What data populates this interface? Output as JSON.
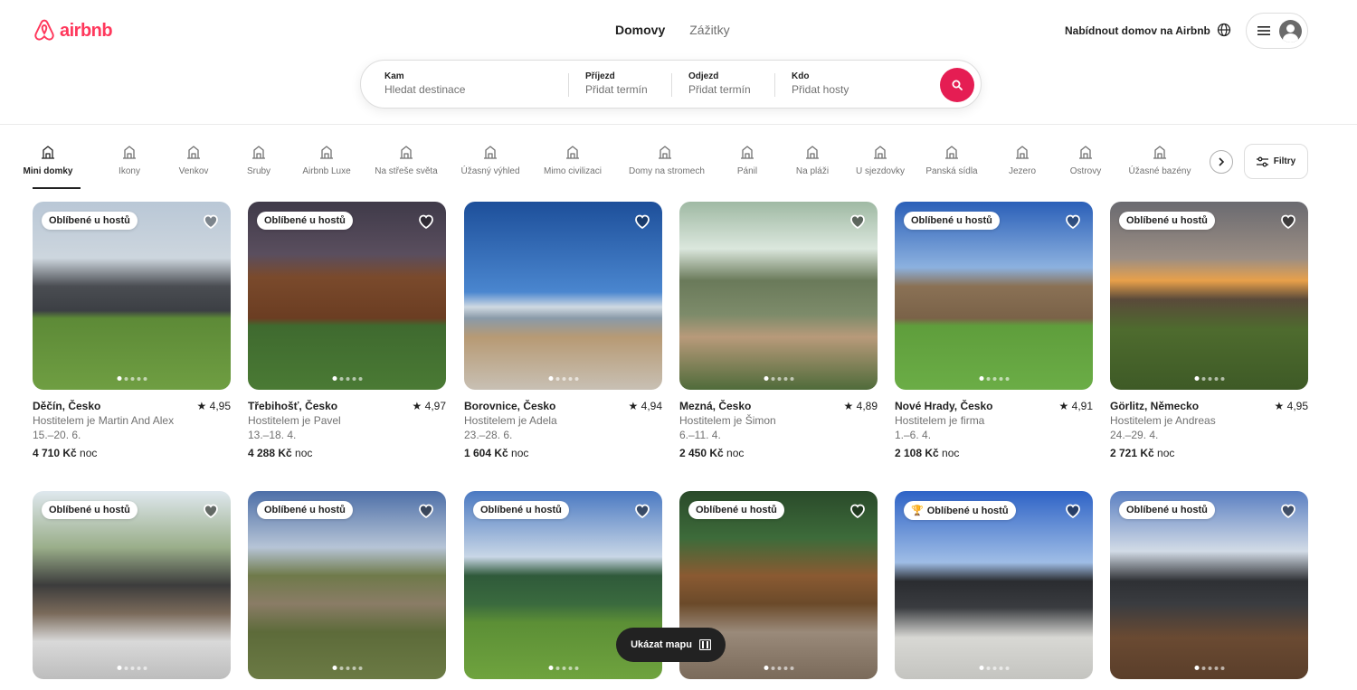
{
  "header": {
    "logo_text": "airbnb",
    "tabs": [
      {
        "label": "Domovy",
        "active": true
      },
      {
        "label": "Zážitky",
        "active": false
      }
    ],
    "host_link": "Nabídnout domov na Airbnb"
  },
  "search": {
    "where": {
      "label": "Kam",
      "placeholder": "Hledat destinace"
    },
    "checkin": {
      "label": "Příjezd",
      "placeholder": "Přidat termín"
    },
    "checkout": {
      "label": "Odjezd",
      "placeholder": "Přidat termín"
    },
    "who": {
      "label": "Kdo",
      "placeholder": "Přidat hosty"
    }
  },
  "categories": [
    {
      "label": "Mini domky",
      "active": true
    },
    {
      "label": "Ikony"
    },
    {
      "label": "Venkov"
    },
    {
      "label": "Sruby"
    },
    {
      "label": "Airbnb Luxe"
    },
    {
      "label": "Na střeše světa"
    },
    {
      "label": "Úžasný výhled"
    },
    {
      "label": "Mimo civilizaci"
    },
    {
      "label": "Domy na stromech"
    },
    {
      "label": "Pánil"
    },
    {
      "label": "Na pláži"
    },
    {
      "label": "U sjezdovky"
    },
    {
      "label": "Panská sídla"
    },
    {
      "label": "Jezero"
    },
    {
      "label": "Ostrovy"
    },
    {
      "label": "Úžasné bazény"
    }
  ],
  "filters_label": "Filtry",
  "listings": [
    {
      "badge": "Oblíbené u hostů",
      "location": "Děčín, Česko",
      "rating": "★ 4,95",
      "host": "Hostitelem je Martin And Alex",
      "dates": "15.–20. 6.",
      "price": "4 710 Kč",
      "unit": "noc"
    },
    {
      "badge": "Oblíbené u hostů",
      "location": "Třebihošť, Česko",
      "rating": "★ 4,97",
      "host": "Hostitelem je Pavel",
      "dates": "13.–18. 4.",
      "price": "4 288 Kč",
      "unit": "noc"
    },
    {
      "badge": "",
      "location": "Borovnice, Česko",
      "rating": "★ 4,94",
      "host": "Hostitelem je Adela",
      "dates": "23.–28. 6.",
      "price": "1 604 Kč",
      "unit": "noc"
    },
    {
      "badge": "",
      "location": "Mezná, Česko",
      "rating": "★ 4,89",
      "host": "Hostitelem je Šimon",
      "dates": "6.–11. 4.",
      "price": "2 450 Kč",
      "unit": "noc"
    },
    {
      "badge": "Oblíbené u hostů",
      "location": "Nové Hrady, Česko",
      "rating": "★ 4,91",
      "host": "Hostitelem je firma",
      "dates": "1.–6. 4.",
      "price": "2 108 Kč",
      "unit": "noc"
    },
    {
      "badge": "Oblíbené u hostů",
      "location": "Görlitz, Německo",
      "rating": "★ 4,95",
      "host": "Hostitelem je Andreas",
      "dates": "24.–29. 4.",
      "price": "2 721 Kč",
      "unit": "noc"
    },
    {
      "badge": "Oblíbené u hostů"
    },
    {
      "badge": "Oblíbené u hostů"
    },
    {
      "badge": "Oblíbené u hostů"
    },
    {
      "badge": "Oblíbené u hostů"
    },
    {
      "badge": "Oblíbené u hostů",
      "trophy": true
    },
    {
      "badge": "Oblíbené u hostů"
    }
  ],
  "map_button": "Ukázat mapu",
  "colors": {
    "brand": "#ff385c",
    "search_button": "#e51d53"
  }
}
